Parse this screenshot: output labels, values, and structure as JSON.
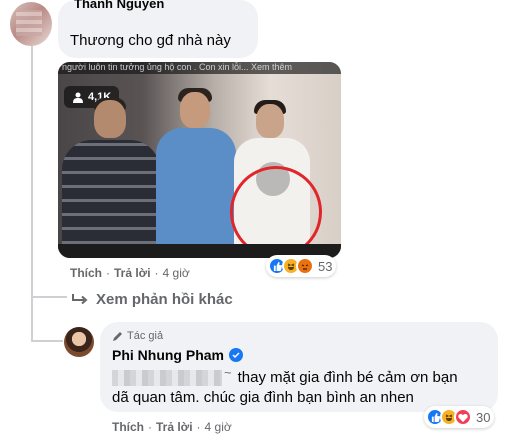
{
  "comment1": {
    "author": "Thanh Nguyen",
    "text": "Thương cho gđ nhà này",
    "video": {
      "overlay_text": "người luôn tin tưởng ủng hộ con . Con xin lỗi... Xem thêm",
      "views": "4,1K"
    },
    "actions": {
      "like": "Thích",
      "reply": "Trả lời",
      "time": "4 giờ"
    },
    "reactions": {
      "icons": [
        "like-icon",
        "haha-icon",
        "angry-icon"
      ],
      "count": "53"
    }
  },
  "see_more_replies": "Xem phản hồi khác",
  "reply": {
    "badge": "Tác giả",
    "author": "Phi Nhung Pham",
    "text_line1": "thay mặt gia đình bé cảm ơn bạn",
    "text_line2": "dã quan tâm. chúc gia đình bạn bình an nhen",
    "actions": {
      "like": "Thích",
      "reply": "Trả lời",
      "time": "4 giờ"
    },
    "reactions": {
      "icons": [
        "like-icon",
        "haha-icon",
        "love-icon"
      ],
      "count": "30"
    }
  },
  "colors": {
    "bubble": "#f0f2f5",
    "secondary_text": "#65676b",
    "facebook_blue": "#1877f2",
    "circle_mark": "#e0262b"
  }
}
